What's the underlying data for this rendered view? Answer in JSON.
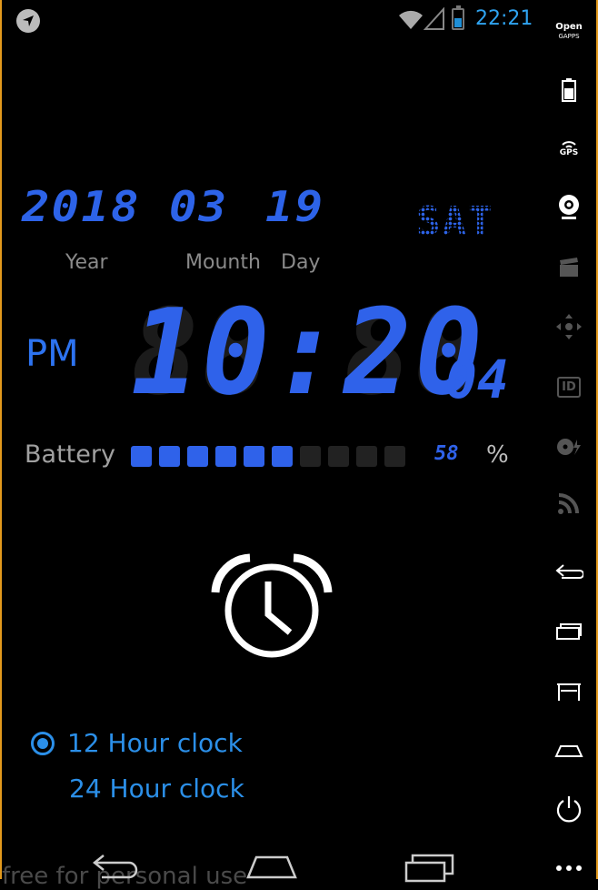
{
  "status_bar": {
    "time": "22:21"
  },
  "rail": {
    "opengapps_line1": "Open",
    "opengapps_line2": "GAPPS",
    "gps_label": "GPS",
    "id_label": "ID"
  },
  "date": {
    "year": "2018",
    "month": "03",
    "day": "19",
    "weekday": "SAT",
    "labels": {
      "year": "Year",
      "month": "Mounth",
      "day": "Day"
    }
  },
  "clock": {
    "ampm": "PM",
    "time": "10:20",
    "ghost": "88:88",
    "seconds": "04"
  },
  "battery": {
    "label": "Battery",
    "value_text": "58",
    "unit": "%",
    "cells_total": 10,
    "cells_on": 6,
    "level_fraction": 0.58
  },
  "options": [
    {
      "label": "12 Hour clock",
      "selected": true
    },
    {
      "label": "24 Hour clock",
      "selected": false
    }
  ],
  "footer": {
    "text": "free for personal use"
  },
  "colors": {
    "accent": "#2f62ea",
    "text_blue": "#2b8fe8",
    "frame": "#e39a1d"
  }
}
